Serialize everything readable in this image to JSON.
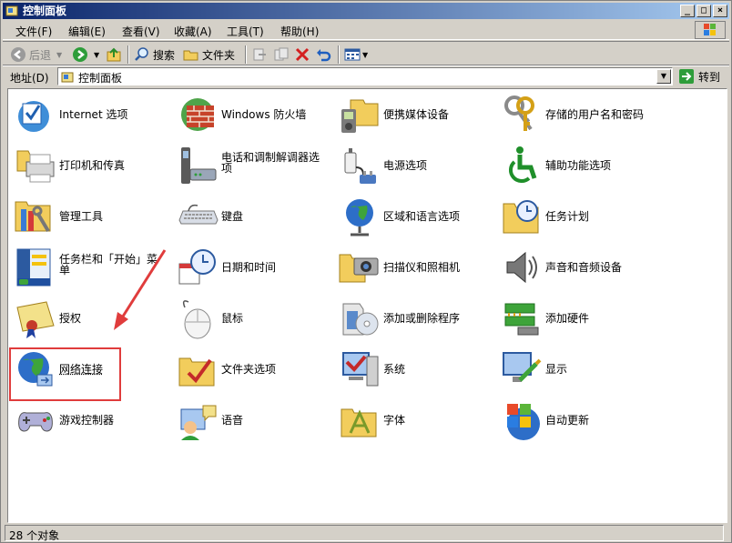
{
  "window": {
    "title": "控制面板"
  },
  "menubar": {
    "items": [
      "文件(F)",
      "编辑(E)",
      "查看(V)",
      "收藏(A)",
      "工具(T)",
      "帮助(H)"
    ]
  },
  "toolbar": {
    "back": "后退",
    "search": "搜索",
    "folders": "文件夹"
  },
  "address": {
    "label": "地址(D)",
    "value": "控制面板",
    "go": "转到"
  },
  "items": [
    {
      "label": "Internet 选项",
      "icon": "internet-options-icon"
    },
    {
      "label": "Windows 防火墙",
      "icon": "firewall-icon"
    },
    {
      "label": "便携媒体设备",
      "icon": "portable-media-icon"
    },
    {
      "label": "存储的用户名和密码",
      "icon": "keys-icon"
    },
    {
      "label": "打印机和传真",
      "icon": "printer-icon"
    },
    {
      "label": "电话和调制解调器选项",
      "icon": "phone-modem-icon"
    },
    {
      "label": "电源选项",
      "icon": "power-icon"
    },
    {
      "label": "辅助功能选项",
      "icon": "accessibility-icon"
    },
    {
      "label": "管理工具",
      "icon": "admin-tools-icon"
    },
    {
      "label": "键盘",
      "icon": "keyboard-icon"
    },
    {
      "label": "区域和语言选项",
      "icon": "globe-icon"
    },
    {
      "label": "任务计划",
      "icon": "scheduled-tasks-icon"
    },
    {
      "label": "任务栏和「开始」菜单",
      "icon": "taskbar-icon"
    },
    {
      "label": "日期和时间",
      "icon": "datetime-icon"
    },
    {
      "label": "扫描仪和照相机",
      "icon": "scanner-icon"
    },
    {
      "label": "声音和音频设备",
      "icon": "speaker-icon"
    },
    {
      "label": "授权",
      "icon": "license-icon"
    },
    {
      "label": "鼠标",
      "icon": "mouse-icon"
    },
    {
      "label": "添加或删除程序",
      "icon": "add-remove-icon"
    },
    {
      "label": "添加硬件",
      "icon": "add-hardware-icon"
    },
    {
      "label": "网络连接",
      "icon": "network-icon"
    },
    {
      "label": "文件夹选项",
      "icon": "folder-options-icon"
    },
    {
      "label": "系统",
      "icon": "system-icon"
    },
    {
      "label": "显示",
      "icon": "display-icon"
    },
    {
      "label": "游戏控制器",
      "icon": "game-controller-icon"
    },
    {
      "label": "语音",
      "icon": "speech-icon"
    },
    {
      "label": "字体",
      "icon": "fonts-icon"
    },
    {
      "label": "自动更新",
      "icon": "windows-update-icon"
    }
  ],
  "status": {
    "text": "28 个对象"
  },
  "colors": {
    "titlebar": "#0a246a",
    "highlight": "#e03c3c"
  }
}
